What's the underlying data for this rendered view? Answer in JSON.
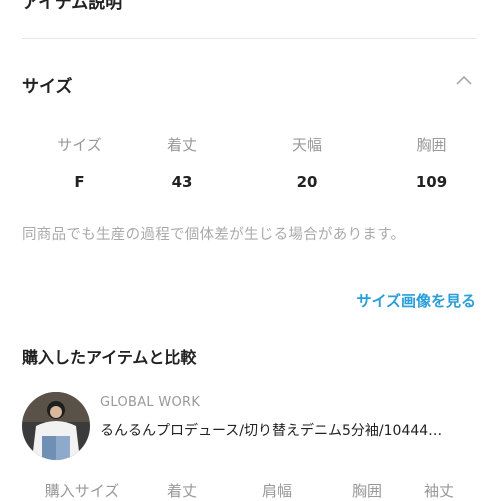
{
  "top_section": {
    "title": "アイテム説明"
  },
  "size_section": {
    "title": "サイズ",
    "columns": [
      "サイズ",
      "着丈",
      "天幅",
      "胸囲"
    ],
    "values": [
      "F",
      "43",
      "20",
      "109"
    ],
    "note": "同商品でも生産の過程で個体差が生じる場合があります。",
    "size_image_link": "サイズ画像を見る",
    "chevron_icon": "chevron-up-icon"
  },
  "compare_section": {
    "title": "購入したアイテムと比較",
    "item": {
      "brand": "GLOBAL WORK",
      "name": "るんるんプロデュース/切り替えデニム5分袖/10444…",
      "avatar_icon": "product-photo"
    },
    "columns": [
      "購入サイズ",
      "着丈",
      "肩幅",
      "胸囲",
      "袖丈"
    ]
  },
  "colors": {
    "link": "#2a9ed9",
    "muted": "#999999",
    "text": "#222222",
    "divider": "#e5e5e5"
  }
}
